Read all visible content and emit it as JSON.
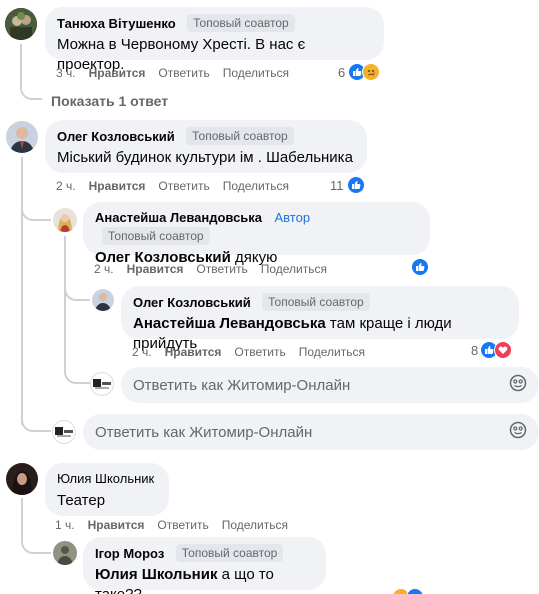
{
  "comments": [
    {
      "author": "Танюха Вітушенко",
      "badge": "Топовый соавтор",
      "text": "Можна в Червоному Хресті. В нас є проектор.",
      "time": "3 ч.",
      "like": "Нравится",
      "reply": "Ответить",
      "share": "Поделиться",
      "reactions": "6"
    },
    {
      "author": "Олег Козловський",
      "badge": "Топовый соавтор",
      "text": "Міський будинок культури ім . Шабельника",
      "time": "2 ч.",
      "like": "Нравится",
      "reply": "Ответить",
      "share": "Поделиться",
      "reactions": "11"
    },
    {
      "author": "Анастейша Левандовська",
      "author_badge": "Автор",
      "badge": "Топовый соавтор",
      "mention": "Олег Козловський",
      "text": "дякую",
      "time": "2 ч.",
      "like": "Нравится",
      "reply": "Ответить",
      "share": "Поделиться"
    },
    {
      "author": "Олег Козловський",
      "badge": "Топовый соавтор",
      "mention": "Анастейша Левандовська",
      "text": "там краще і люди прийдуть",
      "time": "2 ч.",
      "like": "Нравится",
      "reply": "Ответить",
      "share": "Поделиться",
      "reactions": "8"
    },
    {
      "author": "Юлия Школьник",
      "text": "Театер",
      "time": "1 ч.",
      "like": "Нравится",
      "reply": "Ответить",
      "share": "Поделиться"
    },
    {
      "author": "Ігор Мороз",
      "badge": "Топовый соавтор",
      "mention": "Юлия Школьник",
      "text": "а що то таке??"
    }
  ],
  "show_replies": "Показать 1 ответ",
  "reply_placeholder": "Ответить как Житомир-Онлайн",
  "colors": {
    "link_blue": "#1877f2",
    "bubble_bg": "#f0f2f5",
    "muted_text": "#65676b"
  }
}
